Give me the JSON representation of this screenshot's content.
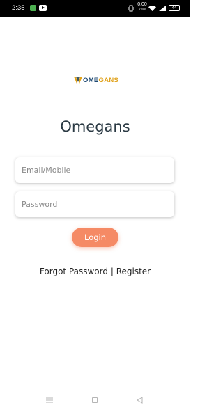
{
  "status_bar": {
    "time": "2:35",
    "net_speed_value": "0.00",
    "net_speed_unit": "KB/S",
    "battery": "44",
    "icons": [
      "notification-app-icon",
      "youtube-icon",
      "vibrate-icon",
      "wifi-icon",
      "signal-icon",
      "battery-icon"
    ]
  },
  "logo": {
    "prefix": "OME",
    "suffix": "GANS",
    "colors": {
      "prefix": "#1f4a73",
      "suffix": "#e0a21b"
    }
  },
  "title": "Omegans",
  "form": {
    "email_placeholder": "Email/Mobile",
    "password_placeholder": "Password",
    "login_label": "Login"
  },
  "links": {
    "forgot_password": "Forgot Password",
    "separator": "|",
    "register": "Register"
  },
  "colors": {
    "accent": "#f58a65",
    "title": "#2b3a44"
  },
  "nav_icons": [
    "menu-icon",
    "home-icon",
    "back-icon"
  ]
}
